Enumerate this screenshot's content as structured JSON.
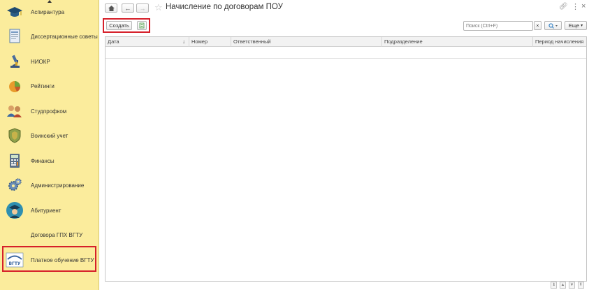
{
  "sidebar": {
    "items": [
      {
        "label": "Аспирантура",
        "icon": "graduation-cap-icon"
      },
      {
        "label": "Диссертационные советы",
        "icon": "document-icon"
      },
      {
        "label": "НИОКР",
        "icon": "microscope-icon"
      },
      {
        "label": "Рейтинги",
        "icon": "pie-chart-icon"
      },
      {
        "label": "Студпрофком",
        "icon": "people-icon"
      },
      {
        "label": "Воинский учет",
        "icon": "shield-icon"
      },
      {
        "label": "Финансы",
        "icon": "calculator-icon"
      },
      {
        "label": "Администрирование",
        "icon": "gears-icon"
      },
      {
        "label": "Абитуриент",
        "icon": "applicant-icon"
      },
      {
        "label": "Договора ГПХ ВГТУ",
        "icon": ""
      },
      {
        "label": "Платное обучение ВГТУ",
        "icon": "vgtu-logo-icon",
        "logo_text": "ВГТУ"
      }
    ]
  },
  "header": {
    "title": "Начисление по договорам ПОУ"
  },
  "toolbar": {
    "create_label": "Создать",
    "search_placeholder": "Поиск (Ctrl+F)",
    "clear_label": "×",
    "more_label": "Еще"
  },
  "table": {
    "columns": [
      "Дата",
      "Номер",
      "Ответственный",
      "Подразделение",
      "Период начисления"
    ],
    "sort_indicator": "↓",
    "rows": []
  },
  "colors": {
    "sidebar_bg": "#fbec9c",
    "highlight": "#d6202a",
    "accent": "#3c86c6"
  }
}
